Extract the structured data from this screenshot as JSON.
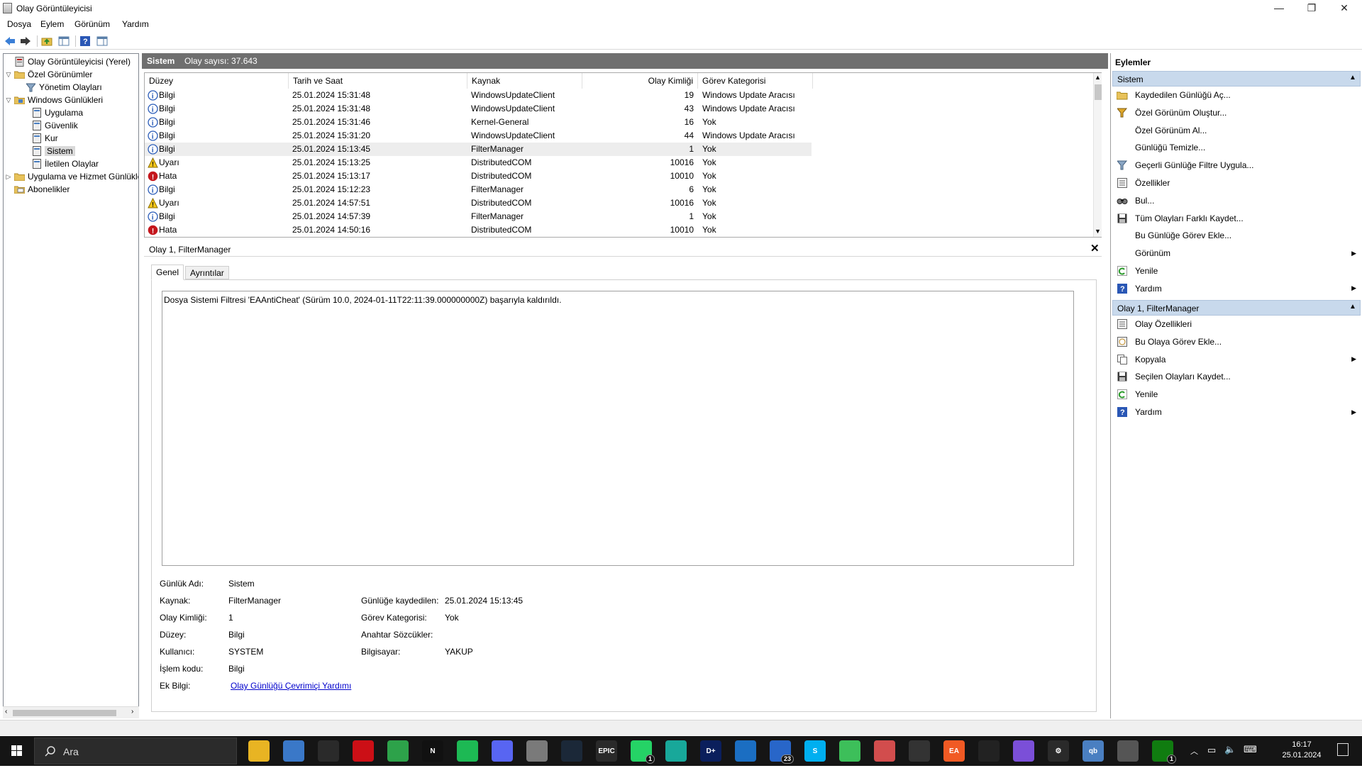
{
  "window": {
    "title": "Olay Görüntüleyicisi"
  },
  "menu": [
    "Dosya",
    "Eylem",
    "Görünüm",
    "Yardım"
  ],
  "tree": [
    {
      "label": "Olay Görüntüleyicisi (Yerel)",
      "icon": "event-viewer-icon"
    },
    {
      "label": "Özel Görünümler",
      "icon": "folder-icon"
    },
    {
      "label": "Yönetim Olayları",
      "icon": "filter-icon"
    },
    {
      "label": "Windows Günlükleri",
      "icon": "folder-icon"
    },
    {
      "label": "Uygulama",
      "icon": "log-icon"
    },
    {
      "label": "Güvenlik",
      "icon": "log-icon"
    },
    {
      "label": "Kur",
      "icon": "log-icon"
    },
    {
      "label": "Sistem",
      "icon": "log-icon"
    },
    {
      "label": "İletilen Olaylar",
      "icon": "log-icon"
    },
    {
      "label": "Uygulama ve Hizmet Günlükleri",
      "icon": "folder-icon"
    },
    {
      "label": "Abonelikler",
      "icon": "subscriptions-icon"
    }
  ],
  "center": {
    "log_name": "Sistem",
    "event_count": "Olay sayısı: 37.643"
  },
  "columns": [
    "Düzey",
    "Tarih ve Saat",
    "Kaynak",
    "Olay Kimliği",
    "Görev Kategorisi"
  ],
  "events": [
    {
      "level": "Bilgi",
      "date": "25.01.2024 15:31:48",
      "source": "WindowsUpdateClient",
      "id": "19",
      "category": "Windows Update Aracısı"
    },
    {
      "level": "Bilgi",
      "date": "25.01.2024 15:31:48",
      "source": "WindowsUpdateClient",
      "id": "43",
      "category": "Windows Update Aracısı"
    },
    {
      "level": "Bilgi",
      "date": "25.01.2024 15:31:46",
      "source": "Kernel-General",
      "id": "16",
      "category": "Yok"
    },
    {
      "level": "Bilgi",
      "date": "25.01.2024 15:31:20",
      "source": "WindowsUpdateClient",
      "id": "44",
      "category": "Windows Update Aracısı"
    },
    {
      "level": "Bilgi",
      "date": "25.01.2024 15:13:45",
      "source": "FilterManager",
      "id": "1",
      "category": "Yok"
    },
    {
      "level": "Uyarı",
      "date": "25.01.2024 15:13:25",
      "source": "DistributedCOM",
      "id": "10016",
      "category": "Yok"
    },
    {
      "level": "Hata",
      "date": "25.01.2024 15:13:17",
      "source": "DistributedCOM",
      "id": "10010",
      "category": "Yok"
    },
    {
      "level": "Bilgi",
      "date": "25.01.2024 15:12:23",
      "source": "FilterManager",
      "id": "6",
      "category": "Yok"
    },
    {
      "level": "Uyarı",
      "date": "25.01.2024 14:57:51",
      "source": "DistributedCOM",
      "id": "10016",
      "category": "Yok"
    },
    {
      "level": "Bilgi",
      "date": "25.01.2024 14:57:39",
      "source": "FilterManager",
      "id": "1",
      "category": "Yok"
    },
    {
      "level": "Hata",
      "date": "25.01.2024 14:50:16",
      "source": "DistributedCOM",
      "id": "10010",
      "category": "Yok"
    }
  ],
  "detail": {
    "header": "Olay 1, FilterManager",
    "close_glyph": "✕",
    "tabs": [
      "Genel",
      "Ayrıntılar"
    ],
    "description": "Dosya Sistemi Filtresi 'EAAntiCheat' (Sürüm 10.0, 2024-01-11T22:11:39.000000000Z) başarıyla kaldırıldı.",
    "fields": {
      "log_name_label": "Günlük Adı:",
      "log_name": "Sistem",
      "source_label": "Kaynak:",
      "source": "FilterManager",
      "logged_label": "Günlüğe kaydedilen:",
      "logged": "25.01.2024 15:13:45",
      "event_id_label": "Olay Kimliği:",
      "event_id": "1",
      "task_label": "Görev Kategorisi:",
      "task": "Yok",
      "level_label": "Düzey:",
      "level": "Bilgi",
      "keywords_label": "Anahtar Sözcükler:",
      "user_label": "Kullanıcı:",
      "user": "SYSTEM",
      "computer_label": "Bilgisayar:",
      "computer": "YAKUP",
      "opcode_label": "İşlem kodu:",
      "opcode": "Bilgi",
      "more_info_label": "Ek Bilgi:",
      "more_info_link": "Olay Günlüğü Çevrimiçi Yardımı"
    }
  },
  "actions": {
    "title": "Eylemler",
    "section1": "Sistem",
    "items1": [
      {
        "label": "Kaydedilen Günlüğü Aç...",
        "icon": "open-log-icon"
      },
      {
        "label": "Özel Görünüm Oluştur...",
        "icon": "filter-create-icon"
      },
      {
        "label": "Özel Görünüm Al...",
        "icon": ""
      },
      {
        "label": "Günlüğü Temizle...",
        "icon": ""
      },
      {
        "label": "Geçerli Günlüğe Filtre Uygula...",
        "icon": "filter-icon"
      },
      {
        "label": "Özellikler",
        "icon": "properties-icon"
      },
      {
        "label": "Bul...",
        "icon": "find-icon"
      },
      {
        "label": "Tüm Olayları Farklı Kaydet...",
        "icon": "save-icon"
      },
      {
        "label": "Bu Günlüğe Görev Ekle...",
        "icon": ""
      },
      {
        "label": "Görünüm",
        "icon": "",
        "submenu": true
      },
      {
        "label": "Yenile",
        "icon": "refresh-icon"
      },
      {
        "label": "Yardım",
        "icon": "help-icon",
        "submenu": true
      }
    ],
    "section2": "Olay 1, FilterManager",
    "items2": [
      {
        "label": "Olay Özellikleri",
        "icon": "properties-icon"
      },
      {
        "label": "Bu Olaya Görev Ekle...",
        "icon": "task-icon"
      },
      {
        "label": "Kopyala",
        "icon": "copy-icon",
        "submenu": true
      },
      {
        "label": "Seçilen Olayları Kaydet...",
        "icon": "save-icon"
      },
      {
        "label": "Yenile",
        "icon": "refresh-icon"
      },
      {
        "label": "Yardım",
        "icon": "help-icon",
        "submenu": true
      }
    ]
  },
  "taskbar": {
    "search_placeholder": "Ara",
    "apps": [
      {
        "name": "file-explorer-icon",
        "color": "#e8b423",
        "text": ""
      },
      {
        "name": "window-app-icon",
        "color": "#3a78c8",
        "text": ""
      },
      {
        "name": "league-icon",
        "color": "#2a2a2a",
        "text": ""
      },
      {
        "name": "opera-icon",
        "color": "#cc0f16",
        "text": ""
      },
      {
        "name": "chrome-icon",
        "color": "#2da24a",
        "text": ""
      },
      {
        "name": "netflix-icon",
        "color": "#111111",
        "text": "N"
      },
      {
        "name": "spotify-icon",
        "color": "#1db954",
        "text": ""
      },
      {
        "name": "discord-icon",
        "color": "#5865f2",
        "text": ""
      },
      {
        "name": "store-icon",
        "color": "#7a7a7a",
        "text": ""
      },
      {
        "name": "steam-icon",
        "color": "#1b2838",
        "text": ""
      },
      {
        "name": "epic-icon",
        "color": "#2a2a2a",
        "text": "EPIC"
      },
      {
        "name": "whatsapp-icon",
        "color": "#25d366",
        "text": "",
        "badge": "1"
      },
      {
        "name": "app-green-icon",
        "color": "#18a89a",
        "text": ""
      },
      {
        "name": "disney-icon",
        "color": "#0b1f5c",
        "text": "D+"
      },
      {
        "name": "mail-icon",
        "color": "#1b6ec2",
        "text": ""
      },
      {
        "name": "calendar-icon",
        "color": "#2866c9",
        "text": "",
        "badge": "23"
      },
      {
        "name": "skype-icon",
        "color": "#00aff0",
        "text": "S"
      },
      {
        "name": "app-lime-icon",
        "color": "#3dbf5a",
        "text": ""
      },
      {
        "name": "game-icon",
        "color": "#d24d4d",
        "text": ""
      },
      {
        "name": "unity-icon",
        "color": "#333333",
        "text": ""
      },
      {
        "name": "ea-icon",
        "color": "#f15a24",
        "text": "EA"
      },
      {
        "name": "ubisoft-icon",
        "color": "#222222",
        "text": ""
      },
      {
        "name": "gamepad-icon",
        "color": "#7b4fd8",
        "text": ""
      },
      {
        "name": "settings-icon",
        "color": "#2a2a2a",
        "text": "⚙"
      },
      {
        "name": "qbittorrent-icon",
        "color": "#4a7fc1",
        "text": "qb"
      },
      {
        "name": "event-viewer-taskbar-icon",
        "color": "#555555",
        "text": ""
      },
      {
        "name": "xbox-icon",
        "color": "#107c10",
        "text": "",
        "badge": "1"
      }
    ],
    "time": "16:17",
    "date": "25.01.2024"
  }
}
